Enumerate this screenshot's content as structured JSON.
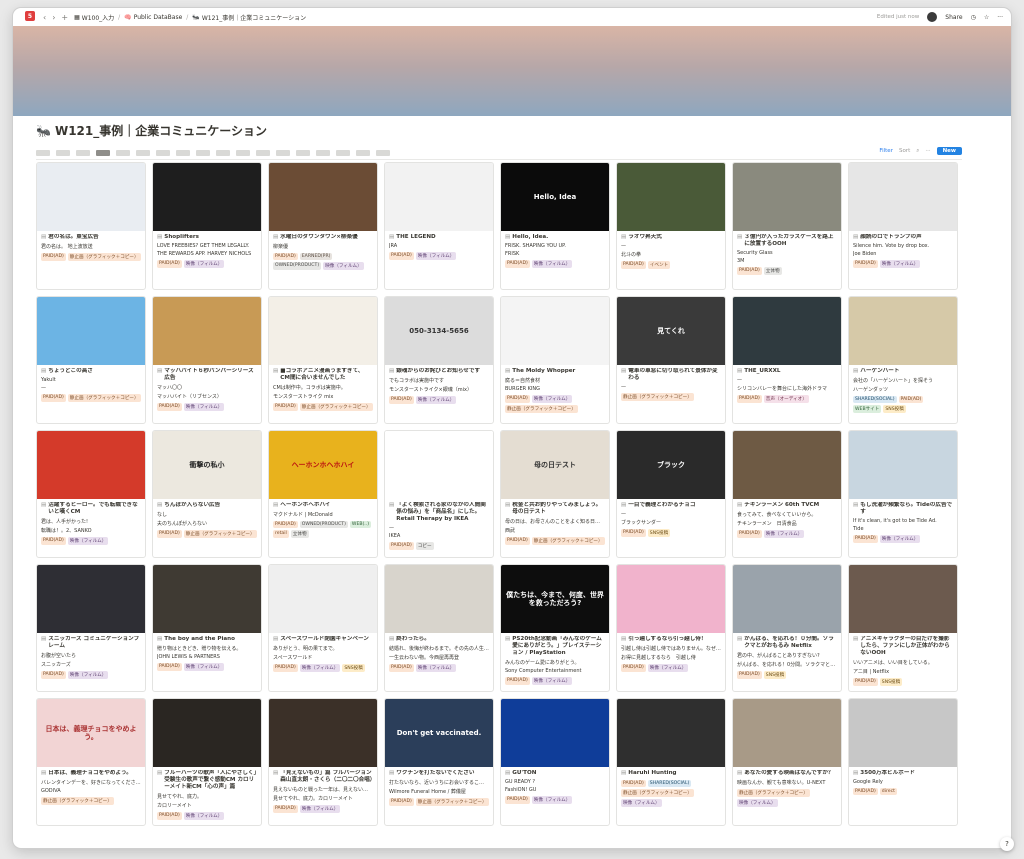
{
  "topbar": {
    "badge": "5",
    "back": "‹",
    "forward": "›",
    "add": "+",
    "crumbs": [
      {
        "icon": "▦",
        "label": "W100_入力"
      },
      {
        "icon": "🧠",
        "label": "Public DataBase"
      },
      {
        "icon": "🐜",
        "label": "W121_事例｜企業コミュニケーション"
      }
    ],
    "edited": "Edited just now",
    "share": "Share"
  },
  "page": {
    "icon": "🐜",
    "title": "W121_事例｜企業コミュニケーション"
  },
  "viewbar": {
    "filter": "Filter",
    "sort": "Sort",
    "new": "New"
  },
  "cards": [
    {
      "title": "君の名は。東宝広告",
      "lines": [
        "君の名は。 地上波放送"
      ],
      "tags": [
        [
          "PAID(AD)",
          "paid"
        ],
        [
          "静止画（グラフィック＋コピー）",
          "graph"
        ]
      ],
      "bg": "#e9edf2",
      "fg": "#333",
      "ov": ""
    },
    {
      "title": "Shoplifters",
      "lines": [
        "LOVE FREEBIES? GET THEM LEGALLY.",
        "THE REWARDS APP. HARVEY NICHOLS"
      ],
      "tags": [
        [
          "PAID(AD)",
          "paid"
        ],
        [
          "映像（フィルム）",
          "film"
        ]
      ],
      "bg": "#1e1e1e",
      "fg": "#ddd",
      "ov": ""
    },
    {
      "title": "水曜日のダウンタウン×柳楽優",
      "lines": [
        "柳楽優"
      ],
      "tags": [
        [
          "PAID(AD)",
          "paid"
        ],
        [
          "EARNED(PR)",
          "earned"
        ],
        [
          "OWNED(PRODUCT)",
          "owned"
        ],
        [
          "映像（フィルム）",
          "film"
        ]
      ],
      "bg": "#6b4c35",
      "fg": "#fff",
      "ov": ""
    },
    {
      "title": "THE LEGEND",
      "lines": [
        "JRA"
      ],
      "tags": [
        [
          "PAID(AD)",
          "paid"
        ],
        [
          "映像（フィルム）",
          "film"
        ]
      ],
      "bg": "#f2f2f2",
      "fg": "#444",
      "ov": ""
    },
    {
      "title": "Hello, Idea.",
      "lines": [
        "FRISK. SHAPING YOU UP.",
        "FRISK"
      ],
      "tags": [
        [
          "PAID(AD)",
          "paid"
        ],
        [
          "映像（フィルム）",
          "film"
        ]
      ],
      "bg": "#0b0b0b",
      "fg": "#fff",
      "ov": "Hello, Idea"
    },
    {
      "title": "ラオウ昇天式",
      "lines": [
        "—",
        "北斗の拳"
      ],
      "tags": [
        [
          "PAID(AD)",
          "paid"
        ],
        [
          "イベント",
          "event"
        ]
      ],
      "bg": "#4a5a38",
      "fg": "#fff",
      "ov": ""
    },
    {
      "title": "３億円が入ったガラスケースを路上に放置するOOH",
      "lines": [
        "Security Glass",
        "3M"
      ],
      "tags": [
        [
          "PAID(AD)",
          "paid"
        ],
        [
          "立体物",
          "fb"
        ]
      ],
      "bg": "#8a8a7e",
      "fg": "#fff",
      "ov": ""
    },
    {
      "title": "顔読のロでトランプの声",
      "lines": [
        "Silence him. Vote by drop box.",
        "Joe Biden"
      ],
      "tags": [
        [
          "PAID(AD)",
          "paid"
        ],
        [
          "映像（フィルム）",
          "film"
        ]
      ],
      "bg": "#e6e6e6",
      "fg": "#222",
      "ov": ""
    },
    {
      "title": "ちょうどこの高さ",
      "lines": [
        "Yakult",
        "—"
      ],
      "tags": [
        [
          "PAID(AD)",
          "paid"
        ],
        [
          "静止画（グラフィック＋コピー）",
          "graph"
        ]
      ],
      "bg": "#6cb4e4",
      "fg": "#fff",
      "ov": ""
    },
    {
      "title": "マッハバイト６秒バンパーシリーズ広告",
      "lines": [
        "マッハ〇〇",
        "マッハバイト（リブセンス）"
      ],
      "tags": [
        [
          "PAID(AD)",
          "paid"
        ],
        [
          "映像（フィルム）",
          "film"
        ]
      ],
      "bg": "#c89a55",
      "fg": "#fff",
      "ov": ""
    },
    {
      "title": "■コラボアニメ漫画うますぎて、CM間に合いませんでした",
      "lines": [
        "CMは制作中。コラボは実施中。",
        "モンスターストライク mix"
      ],
      "tags": [
        [
          "PAID(AD)",
          "paid"
        ],
        [
          "静止画（グラフィック＋コピー）",
          "graph"
        ]
      ],
      "bg": "#f3efe7",
      "fg": "#333",
      "ov": ""
    },
    {
      "title": "銀魂からのお詫びとお知らせです",
      "lines": [
        "でもコラボは実施中です",
        "モンスターストライク×銀魂（mix）"
      ],
      "tags": [
        [
          "PAID(AD)",
          "paid"
        ],
        [
          "映像（フィルム）",
          "film"
        ]
      ],
      "bg": "#dcdcdc",
      "fg": "#333",
      "ov": "050-3134-5656"
    },
    {
      "title": "The Moldy Whopper",
      "lines": [
        "腐る＝自然食材",
        "BURGER KING"
      ],
      "tags": [
        [
          "PAID(AD)",
          "paid"
        ],
        [
          "映像（フィルム）",
          "film"
        ],
        [
          "静止画（グラフィック＋コピー）",
          "graph"
        ]
      ],
      "bg": "#f4f4f4",
      "fg": "#333",
      "ov": ""
    },
    {
      "title": "電車の車窓に切り取られて景体が変わる",
      "lines": [
        "—"
      ],
      "tags": [
        [
          "静止画（グラフィック＋コピー）",
          "graph"
        ]
      ],
      "bg": "#3a3a3a",
      "fg": "#fff",
      "ov": "見てくれ"
    },
    {
      "title": "THE_URXXL",
      "lines": [
        "—",
        "シリコンバレーを舞台にした海外ドラマ"
      ],
      "tags": [
        [
          "PAID(AD)",
          "paid"
        ],
        [
          "音声（オーディオ）",
          "radio"
        ]
      ],
      "bg": "#2f3a3f",
      "fg": "#fff",
      "ov": ""
    },
    {
      "title": "ハーゲンハート",
      "lines": [
        "会社の「ハーゲンハート」を探そう",
        "ハーゲンダッツ"
      ],
      "tags": [
        [
          "SHARED(SOCIAL)",
          "shared"
        ],
        [
          "PAID(AD)",
          "paid"
        ],
        [
          "WEBサイト",
          "web"
        ],
        [
          "SNS投稿",
          "sns"
        ]
      ],
      "bg": "#d6c9a8",
      "fg": "#333",
      "ov": ""
    },
    {
      "title": "活躍するヒーロー。でも転職できないと嘆くCM",
      "lines": [
        "君は、人手がかった!",
        "転職は！。2、SANKO"
      ],
      "tags": [
        [
          "PAID(AD)",
          "paid"
        ],
        [
          "映像（フィルム）",
          "film"
        ]
      ],
      "bg": "#d43a2a",
      "fg": "#fff",
      "ov": ""
    },
    {
      "title": "ちんぽが入らない広告",
      "lines": [
        "なし",
        "夫のちんぽが入らない"
      ],
      "tags": [
        [
          "PAID(AD)",
          "paid"
        ],
        [
          "静止画（グラフィック＋コピー）",
          "graph"
        ]
      ],
      "bg": "#ece8df",
      "fg": "#222",
      "ov": "衝撃の私小"
    },
    {
      "title": "ヘーホンホヘホハイ",
      "lines": [
        "マクドナルド | McDonald"
      ],
      "tags": [
        [
          "PAID(AD)",
          "paid"
        ],
        [
          "OWNED(PRODUCT)",
          "owned"
        ],
        [
          "WEB(..)",
          "web"
        ],
        [
          "retail",
          "hm"
        ],
        [
          "立体物",
          "fb"
        ]
      ],
      "bg": "#e8b21d",
      "fg": "#b11",
      "ov": "ヘーホンホヘホハイ"
    },
    {
      "title": "「よく検索される家のなかの人間関係の悩み」を「商品名」にした。Retail Therapy by IKEA",
      "lines": [
        "—",
        "IKEA"
      ],
      "tags": [
        [
          "PAID(AD)",
          "paid"
        ],
        [
          "コピー",
          "owned"
        ]
      ],
      "bg": "#ffffff",
      "fg": "#222",
      "ov": ""
    },
    {
      "title": "税金と共お釣りやってみましょう。母の日テスト",
      "lines": [
        "母の日は、お母さんのことをよく知る日にしましょう。",
        "西武"
      ],
      "tags": [
        [
          "PAID(AD)",
          "paid"
        ],
        [
          "静止画（グラフィック＋コピー）",
          "graph"
        ]
      ],
      "bg": "#e4ddd2",
      "fg": "#333",
      "ov": "母の日テスト"
    },
    {
      "title": "一目で義理とわかるチョコ",
      "lines": [
        "—",
        "ブラックサンダー"
      ],
      "tags": [
        [
          "PAID(AD)",
          "paid"
        ],
        [
          "SNS投稿",
          "sns"
        ]
      ],
      "bg": "#2a2a2a",
      "fg": "#fff",
      "ov": "ブラック"
    },
    {
      "title": "チキンラーメン 60th TVCM",
      "lines": [
        "食ってみて、食べなくていいから。",
        "チキンラーメン　日清食品"
      ],
      "tags": [
        [
          "PAID(AD)",
          "paid"
        ],
        [
          "映像（フィルム）",
          "film"
        ]
      ],
      "bg": "#6e5a44",
      "fg": "#fff",
      "ov": ""
    },
    {
      "title": "もし洗濯が頻繁なら。Tideの広告です",
      "lines": [
        "If it's clean, it's got to be Tide Ad.",
        "Tide"
      ],
      "tags": [
        [
          "PAID(AD)",
          "paid"
        ],
        [
          "映像（フィルム）",
          "film"
        ]
      ],
      "bg": "#c8d6e0",
      "fg": "#333",
      "ov": ""
    },
    {
      "title": "スニッカーズ コミュニケーションフレーム",
      "lines": [
        "お腹が空いたら",
        "スニッカーズ"
      ],
      "tags": [
        [
          "PAID(AD)",
          "paid"
        ],
        [
          "映像（フィルム）",
          "film"
        ]
      ],
      "bg": "#2e2e34",
      "fg": "#fff",
      "ov": ""
    },
    {
      "title": "The boy and the Piano",
      "lines": [
        "贈り物はときどき、贈り物を伝える。",
        "JOHN LEWIS & PARTNERS"
      ],
      "tags": [
        [
          "PAID(AD)",
          "paid"
        ],
        [
          "映像（フィルム）",
          "film"
        ]
      ],
      "bg": "#3f3a33",
      "fg": "#ddd",
      "ov": ""
    },
    {
      "title": "スペースワールド閉園キャンペーン",
      "lines": [
        "ありがとう、明の果てまで。",
        "スペースワールド"
      ],
      "tags": [
        [
          "PAID(AD)",
          "paid"
        ],
        [
          "映像（フィルム）",
          "film"
        ],
        [
          "SNS投稿",
          "sns"
        ]
      ],
      "bg": "#efefef",
      "fg": "#333",
      "ov": ""
    },
    {
      "title": "終わったら。",
      "lines": [
        "結婚れ、後悔が終わるまで。その先の人生も。",
        "一生云わない物。今西屋再再登"
      ],
      "tags": [
        [
          "PAID(AD)",
          "paid"
        ],
        [
          "映像（フィルム）",
          "film"
        ]
      ],
      "bg": "#d8d4cc",
      "fg": "#333",
      "ov": ""
    },
    {
      "title": "PS20th記念動画「みんなのゲーム愛にありがとう。」プレイステーション / PlayStation",
      "lines": [
        "みんなのゲーム愛にありがとう。",
        "Sony Computer Entertainment"
      ],
      "tags": [
        [
          "PAID(AD)",
          "paid"
        ],
        [
          "映像（フィルム）",
          "film"
        ]
      ],
      "bg": "#0d0d0d",
      "fg": "#fff",
      "ov": "僕たちは、今まで、何度、世界を救っただろう?"
    },
    {
      "title": "引っ越しするなら引っ越し侍！",
      "lines": [
        "引越し侍は引越し侍ではありません。なぜなら…",
        "お得に見越しするなら　引越し侍"
      ],
      "tags": [
        [
          "PAID(AD)",
          "paid"
        ],
        [
          "映像（フィルム）",
          "film"
        ]
      ],
      "bg": "#f1b3cc",
      "fg": "#fff",
      "ov": ""
    },
    {
      "title": "がんばる、を応れる！０分間。ソラクマとがおもるみ Netflix",
      "lines": [
        "君の中、がんばることありすぎない?",
        "がんばる、を応れる！0分間。ソラクマとがおもるみ"
      ],
      "tags": [
        [
          "PAID(AD)",
          "paid"
        ],
        [
          "SNS投稿",
          "sns"
        ]
      ],
      "bg": "#9aa3ab",
      "fg": "#fff",
      "ov": ""
    },
    {
      "title": "アニメキャラクターの目だけを撮影したら、ファンにしか正体がわからないOOH",
      "lines": [
        "いいアニメは、いい目をしている。",
        "アニ目 | Netflix"
      ],
      "tags": [
        [
          "PAID(AD)",
          "paid"
        ],
        [
          "SNS投稿",
          "sns"
        ]
      ],
      "bg": "#6c5a4e",
      "fg": "#fff",
      "ov": ""
    },
    {
      "title": "日本は、義理チョコをやめよう。",
      "lines": [
        "バレンタインデーを、好きになってください。",
        "GODIVA"
      ],
      "tags": [
        [
          "静止画（グラフィック＋コピー）",
          "graph"
        ]
      ],
      "bg": "#f2d4d4",
      "fg": "#a33",
      "ov": "日本は、義理チョコをやめよう。"
    },
    {
      "title": "ブルーハーツの歌声「人にやさしく」受験生の歌声で繋ぐ感動CM カロリーメイト新CM「心の声」篇",
      "lines": [
        "見せてやれ、底力。",
        "カロリーメイト"
      ],
      "tags": [
        [
          "PAID(AD)",
          "paid"
        ],
        [
          "映像（フィルム）",
          "film"
        ]
      ],
      "bg": "#2a2622",
      "fg": "#ccc",
      "ov": ""
    },
    {
      "title": "「見えないもの」篇 フルバージョン 森山直太朗・さくら（二〇二〇合唱）",
      "lines": [
        "見えないものと戦った一年は、見えないものに支えられた一年だった。",
        "見せてやれ、底力。カロリーメイト"
      ],
      "tags": [
        [
          "PAID(AD)",
          "paid"
        ],
        [
          "映像（フィルム）",
          "film"
        ]
      ],
      "bg": "#3b3028",
      "fg": "#ccc",
      "ov": ""
    },
    {
      "title": "ワクチンを打たないでください",
      "lines": [
        "打たないなら、近いうちにお会いすることになります。",
        "Wilmore Funeral Home / 葬儀屋"
      ],
      "tags": [
        [
          "PAID(AD)",
          "paid"
        ],
        [
          "静止画（グラフィック＋コピー）",
          "graph"
        ]
      ],
      "bg": "#2b3e5a",
      "fg": "#fff",
      "ov": "Don't get vaccinated."
    },
    {
      "title": "GU'TON",
      "lines": [
        "GU READY ?",
        "FashiON! GU"
      ],
      "tags": [
        [
          "PAID(AD)",
          "paid"
        ],
        [
          "映像（フィルム）",
          "film"
        ]
      ],
      "bg": "#0f3d99",
      "fg": "#fff",
      "ov": ""
    },
    {
      "title": "Haruhi Hunting",
      "lines": [],
      "tags": [
        [
          "PAID(AD)",
          "paid"
        ],
        [
          "SHARED(SOCIAL)",
          "shared"
        ],
        [
          "静止画（グラフィック＋コピー）",
          "graph"
        ],
        [
          "映像（フィルム）",
          "film"
        ]
      ],
      "bg": "#2f2f2f",
      "fg": "#fff",
      "ov": ""
    },
    {
      "title": "あなたの愛する映画はなんですか？",
      "lines": [
        "映画なんか、観ても意味ない。U-NEXT"
      ],
      "tags": [
        [
          "静止画（グラフィック＋コピー）",
          "graph"
        ],
        [
          "映像（フィルム）",
          "film"
        ]
      ],
      "bg": "#a89a87",
      "fg": "#fff",
      "ov": ""
    },
    {
      "title": "3500万本ビルボード",
      "lines": [
        "Google Rely"
      ],
      "tags": [
        [
          "PAID(AD)",
          "paid"
        ],
        [
          "direct",
          "direct"
        ]
      ],
      "bg": "#c7c7c7",
      "fg": "#fff",
      "ov": ""
    }
  ]
}
